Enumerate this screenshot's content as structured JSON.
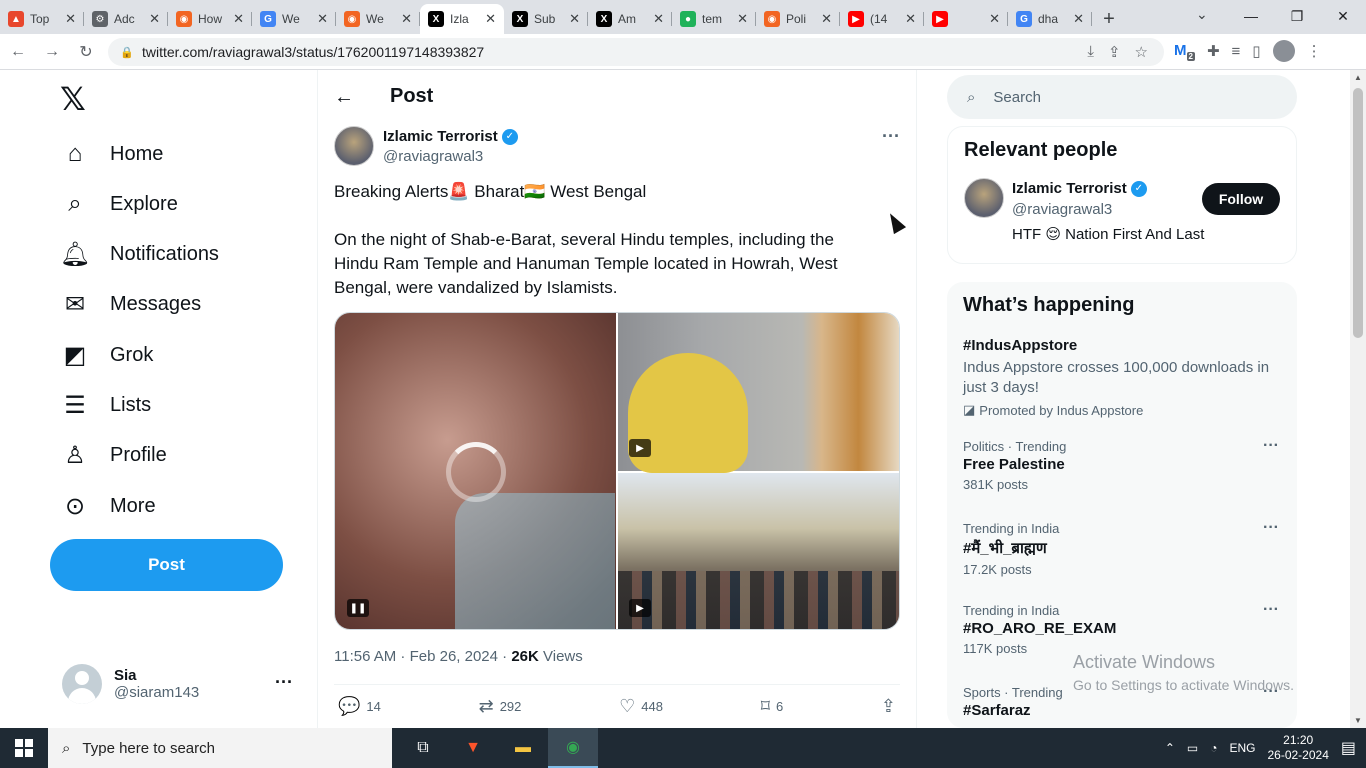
{
  "browser": {
    "tabs": [
      {
        "label": "Top",
        "color": "#e8472d",
        "glyph": "▲"
      },
      {
        "label": "Adc",
        "color": "#5f6368",
        "glyph": "⚙"
      },
      {
        "label": "How",
        "color": "#f26522",
        "glyph": "◉"
      },
      {
        "label": "We",
        "color": "#4285f4",
        "glyph": "G"
      },
      {
        "label": "We",
        "color": "#f26522",
        "glyph": "◉"
      },
      {
        "label": "Izla",
        "color": "#000000",
        "glyph": "X"
      },
      {
        "label": "Sub",
        "color": "#000000",
        "glyph": "X"
      },
      {
        "label": "Am",
        "color": "#000000",
        "glyph": "X"
      },
      {
        "label": "tem",
        "color": "#20b25a",
        "glyph": "●"
      },
      {
        "label": "Poli",
        "color": "#f26522",
        "glyph": "◉"
      },
      {
        "label": "(14",
        "color": "#ff0000",
        "glyph": "▶"
      },
      {
        "label": "",
        "color": "#ff0000",
        "glyph": "▶"
      },
      {
        "label": "dha",
        "color": "#4285f4",
        "glyph": "G"
      }
    ],
    "url": "twitter.com/raviagrawal3/status/1762001197148393827",
    "ext_badge": "2"
  },
  "nav": {
    "items": [
      {
        "label": "Home",
        "icon": "home-icon"
      },
      {
        "label": "Explore",
        "icon": "search-icon"
      },
      {
        "label": "Notifications",
        "icon": "bell-icon"
      },
      {
        "label": "Messages",
        "icon": "mail-icon"
      },
      {
        "label": "Grok",
        "icon": "grok-icon"
      },
      {
        "label": "Lists",
        "icon": "list-icon"
      },
      {
        "label": "Profile",
        "icon": "person-icon"
      },
      {
        "label": "More",
        "icon": "more-circle-icon"
      }
    ],
    "post_label": "Post",
    "account": {
      "name": "Sia",
      "handle": "@siaram143"
    }
  },
  "main": {
    "header_title": "Post",
    "author": {
      "name": "Izlamic Terrorist",
      "handle": "@raviagrawal3"
    },
    "text_line1": "Breaking Alerts🚨 Bharat🇮🇳 West Bengal",
    "text_line2": "On the night of Shab-e-Barat, several Hindu temples, including the Hindu Ram Temple and Hanuman Temple located in Howrah, West Bengal, were vandalized by Islamists.",
    "meta_time": "11:56 AM · Feb 26, 2024 · ",
    "meta_views_count": "26K",
    "meta_views_label": " Views",
    "actions": {
      "replies": "14",
      "reposts": "292",
      "likes": "448",
      "bookmarks": "6"
    }
  },
  "right": {
    "search_placeholder": "Search",
    "relevant_title": "Relevant people",
    "person": {
      "name": "Izlamic Terrorist",
      "handle": "@raviagrawal3",
      "bio": "HTF 😌 Nation First And Last",
      "follow_label": "Follow"
    },
    "happening_title": "What’s happening",
    "promo": {
      "title": "#IndusAppstore",
      "desc": "Indus Appstore crosses 100,000 downloads in just 3 days!",
      "by": "Promoted by Indus Appstore"
    },
    "trends": [
      {
        "context": "Politics · Trending",
        "title": "Free Palestine",
        "count": "381K posts"
      },
      {
        "context": "Trending in India",
        "title": "#मैं_भी_ब्राह्मण",
        "count": "17.2K posts"
      },
      {
        "context": "Trending in India",
        "title": "#RO_ARO_RE_EXAM",
        "count": "117K posts"
      },
      {
        "context": "Sports · Trending",
        "title": "#Sarfaraz",
        "count": ""
      }
    ]
  },
  "watermark": {
    "line1": "Activate Windows",
    "line2": "Go to Settings to activate Windows."
  },
  "taskbar": {
    "search_placeholder": "Type here to search",
    "lang": "ENG",
    "time": "21:20",
    "date": "26-02-2024"
  }
}
